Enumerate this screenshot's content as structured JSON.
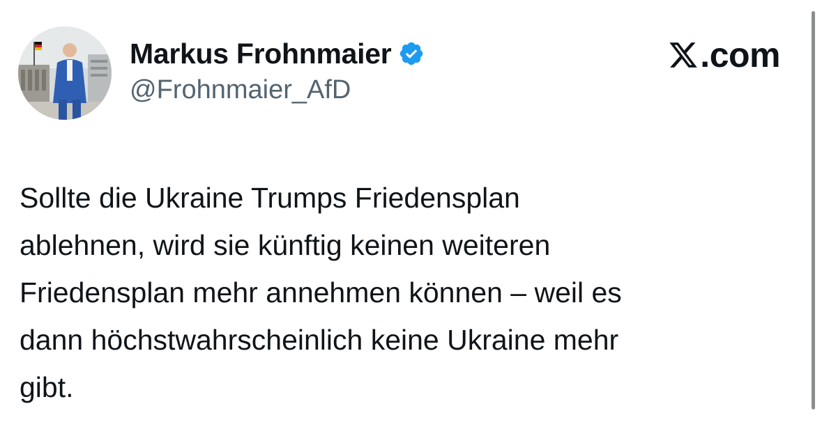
{
  "author": {
    "display_name": "Markus Frohnmaier",
    "handle": "@Frohnmaier_AfD",
    "verified": true
  },
  "brand": {
    "label": ".com",
    "icon": "x-logo-icon"
  },
  "tweet": {
    "text": "Sollte die Ukraine Trumps Friedensplan\nablehnen, wird sie künftig keinen weiteren\nFriedensplan mehr annehmen können – weil es\ndann höchstwahrscheinlich keine Ukraine mehr\ngibt."
  },
  "colors": {
    "text": "#0f1419",
    "secondary": "#536471",
    "verified_badge": "#1d9bf0",
    "background": "#ffffff"
  }
}
